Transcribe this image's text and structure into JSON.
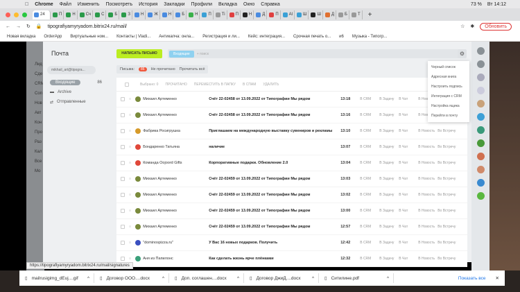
{
  "menubar": {
    "app": "Chrome",
    "items": [
      "Файл",
      "Изменить",
      "Посмотреть",
      "История",
      "Закладки",
      "Профили",
      "Вкладка",
      "Окно",
      "Справка"
    ],
    "battery": "73 %",
    "clock": "Вт 14:12"
  },
  "tabs": [
    "24",
    "П",
    "Н",
    "Сч",
    "С",
    "Б",
    "З",
    "Н",
    "Ж",
    "Н",
    "Б",
    "Н",
    "П",
    "Ti",
    "П",
    "Н",
    "Д",
    "П",
    "Al",
    "Ш",
    "Ш",
    "Д",
    "Б",
    "Т"
  ],
  "address": {
    "url": "tipografiyamyryadom.bitrix24.ru/mail/",
    "update": "Обновить"
  },
  "bookmarks": [
    "Новая вкладка",
    "OrderApp",
    "Виртуальные ном...",
    "Контакты | Vladi...",
    "Антикапча: онла...",
    "Регистрация и ли...",
    "Кейс: интеграция...",
    "Срочная печать о...",
    "и6",
    "Музыка - Типогр..."
  ],
  "left_menu": [
    "Лид",
    "Сде",
    "CRM",
    "Соп",
    "Нов",
    "Авт",
    "Кон",
    "Про",
    "Раз",
    "Кал",
    "Все",
    "Мо"
  ],
  "mail": {
    "title": "Почта",
    "compose": "НАПИСАТЬ ПИСЬМО",
    "filter_chip": "Входящие",
    "search_placeholder": "+ поиск",
    "account": "mikhail_art@tipogra...",
    "folders": [
      {
        "label": "Входящие",
        "count": "86"
      },
      {
        "label": "Archive"
      },
      {
        "label": "Отправленные"
      }
    ],
    "filter": {
      "label": "Письма:",
      "count": "86",
      "unread": "Не прочитано",
      "read_all": "Прочитать всё"
    },
    "toolbar": [
      "Выбрано: 0",
      "ПРОЧИТАНО",
      "ПЕРЕМЕСТИТЬ В ПАПКУ",
      "В СПАМ",
      "УДАЛИТЬ"
    ],
    "actions": [
      "В CRM",
      "В Задачу",
      "В Чат",
      "В Новость",
      "Во Встречу"
    ],
    "rows": [
      {
        "from": "Михаил Артеменко",
        "subject": "Счёт 22-02458 от 13.09.2022 от Типографии Мы рядом",
        "time": "13:18",
        "color": "#7a8a3c"
      },
      {
        "from": "Михаил Артеменко",
        "subject": "Счёт 22-02458 от 13.09.2022 от Типографии Мы рядом",
        "time": "13:16",
        "color": "#7a8a3c"
      },
      {
        "from": "Фабрика Росигрушка",
        "subject": "Приглашаем на международную выставку сувениров и рекламы",
        "time": "13:10",
        "color": "#d69a2a"
      },
      {
        "from": "Бондаренко Татьяна",
        "subject": "наличие",
        "time": "13:07",
        "color": "#e0483a"
      },
      {
        "from": "Команда Oojoord Gifts",
        "subject": "Корпоративные подарки. Обновление 2.0",
        "time": "13:04",
        "color": "#e0483a"
      },
      {
        "from": "Михаил Артеменко",
        "subject": "Счёт 22-02459 от 13.09.2022 от Типографии Мы рядом",
        "time": "13:03",
        "color": "#7a8a3c"
      },
      {
        "from": "Михаил Артеменко",
        "subject": "Счёт 22-02459 от 13.09.2022 от Типографии Мы рядом",
        "time": "13:02",
        "color": "#7a8a3c"
      },
      {
        "from": "Михаил Артеменко",
        "subject": "Счёт 22-02459 от 13.09.2022 от Типографии Мы рядом",
        "time": "13:00",
        "color": "#7a8a3c"
      },
      {
        "from": "Михаил Артеменко",
        "subject": "Счёт 22-02459 от 13.09.2022 от Типографии Мы рядом",
        "time": "12:57",
        "color": "#7a8a3c"
      },
      {
        "from": "\"dominospizza.ru\"",
        "subject": "У Вас 16 новых подарков. Получить",
        "time": "12:42",
        "color": "#3a4fc0"
      },
      {
        "from": "Аня из Папилонс",
        "subject": "Как сделать жизнь ярче плёнками",
        "time": "12:32",
        "color": "#3aa07a"
      }
    ]
  },
  "settings_menu": [
    "Черный список",
    "Адресная книга",
    "Настроить подпись",
    "Интеграция с CRM",
    "Настройка ящика",
    "Перейти в почту"
  ],
  "status_url": "https://tipografiyamyryadom.bitrix24.ru/mail/signatures",
  "downloads": {
    "items": [
      "mailrusigimg_dEuj....gif",
      "Договор ООО....docx",
      "Доп. соглашен....docx",
      "Договор ДжиД....docx",
      "Ситилине.pdf"
    ],
    "show_all": "Показать все"
  }
}
